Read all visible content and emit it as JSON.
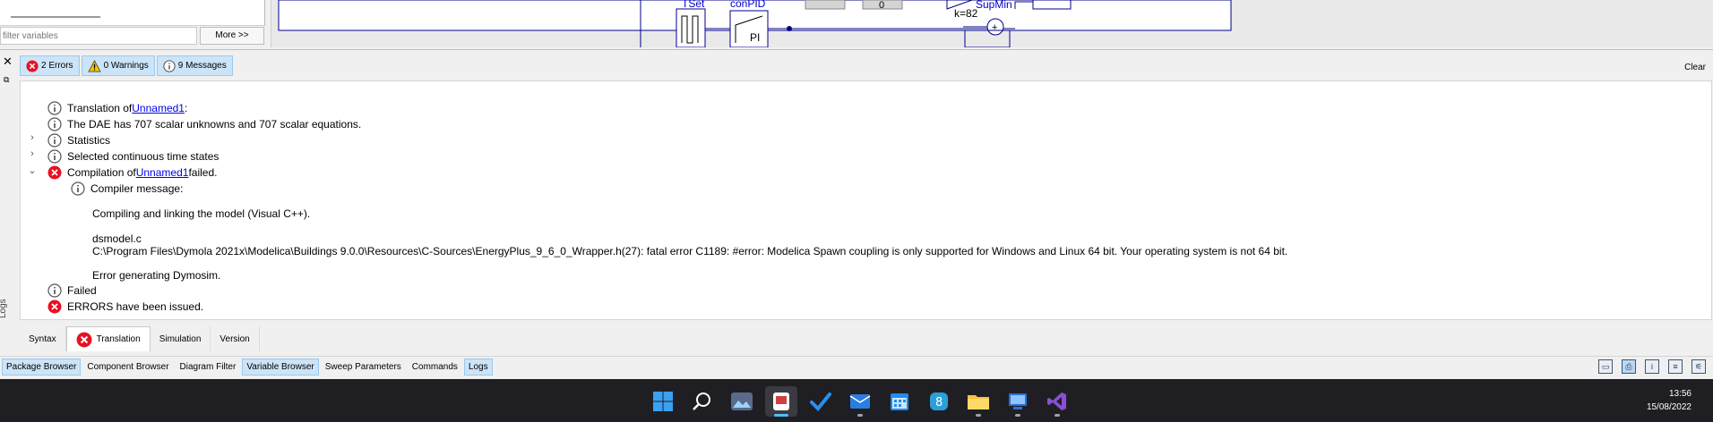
{
  "variable_browser": {
    "filter_placeholder": "filter variables",
    "more_button": "More >>"
  },
  "diagram": {
    "tset_label": "TSet",
    "conpid_label": "conPID",
    "pi_label": "PI",
    "zero_value": "0",
    "k_label": "k=82",
    "supmin_label": "SupMin",
    "plus_sign": "+"
  },
  "messages": {
    "filters": [
      {
        "icon": "error-icon",
        "label": "2 Errors"
      },
      {
        "icon": "warning-icon",
        "label": "0 Warnings"
      },
      {
        "icon": "info-icon",
        "label": "9 Messages"
      }
    ],
    "clear_label": "Clear",
    "side_label": "Logs",
    "log": {
      "translation_prefix": "Translation of ",
      "model_name": "Unnamed1",
      "translation_suffix": ":",
      "dae_line": "The DAE has 707 scalar unknowns and 707 scalar equations.",
      "statistics": "Statistics",
      "selected_states": "Selected continuous time states",
      "compilation_prefix": "Compilation of ",
      "compilation_suffix": " failed.",
      "compiler_message": "Compiler message:",
      "compiling_line": "Compiling and linking the model (Visual C++).",
      "dsmodel": "dsmodel.c",
      "fatal_error": "C:\\Program Files\\Dymola 2021x\\Modelica\\Buildings 9.0.0\\Resources\\C-Sources\\EnergyPlus_9_6_0_Wrapper.h(27): fatal error C1189: #error: Modelica Spawn coupling is only supported for Windows and Linux 64 bit. Your operating system is not 64 bit.",
      "error_generating": "Error generating Dymosim.",
      "failed": "Failed",
      "errors_issued": "ERRORS have been issued."
    }
  },
  "log_tabs": [
    {
      "label": "Syntax",
      "icon": null,
      "active": false
    },
    {
      "label": "Translation",
      "icon": "error-icon",
      "active": true
    },
    {
      "label": "Simulation",
      "icon": null,
      "active": false
    },
    {
      "label": "Version",
      "icon": null,
      "active": false
    }
  ],
  "browser_tabs": [
    {
      "label": "Package Browser",
      "on": true
    },
    {
      "label": "Component Browser",
      "on": false
    },
    {
      "label": "Diagram Filter",
      "on": false
    },
    {
      "label": "Variable Browser",
      "on": true
    },
    {
      "label": "Sweep Parameters",
      "on": false
    },
    {
      "label": "Commands",
      "on": false
    },
    {
      "label": "Logs",
      "on": true
    }
  ],
  "taskbar": {
    "icons": [
      "windows-start-icon",
      "search-icon",
      "photos-icon",
      "snipping-tool-icon",
      "todo-icon",
      "mail-icon",
      "calendar-icon",
      "app-8-icon",
      "file-explorer-icon",
      "remote-desktop-icon",
      "visual-studio-icon"
    ],
    "time": "13:56",
    "date": "15/08/2022"
  },
  "colors": {
    "error": "#e81123",
    "info": "#555555",
    "warning": "#f2c500",
    "link": "#0000ee",
    "tab_highlight": "#cce4f7",
    "diagram_line": "#00008b"
  }
}
